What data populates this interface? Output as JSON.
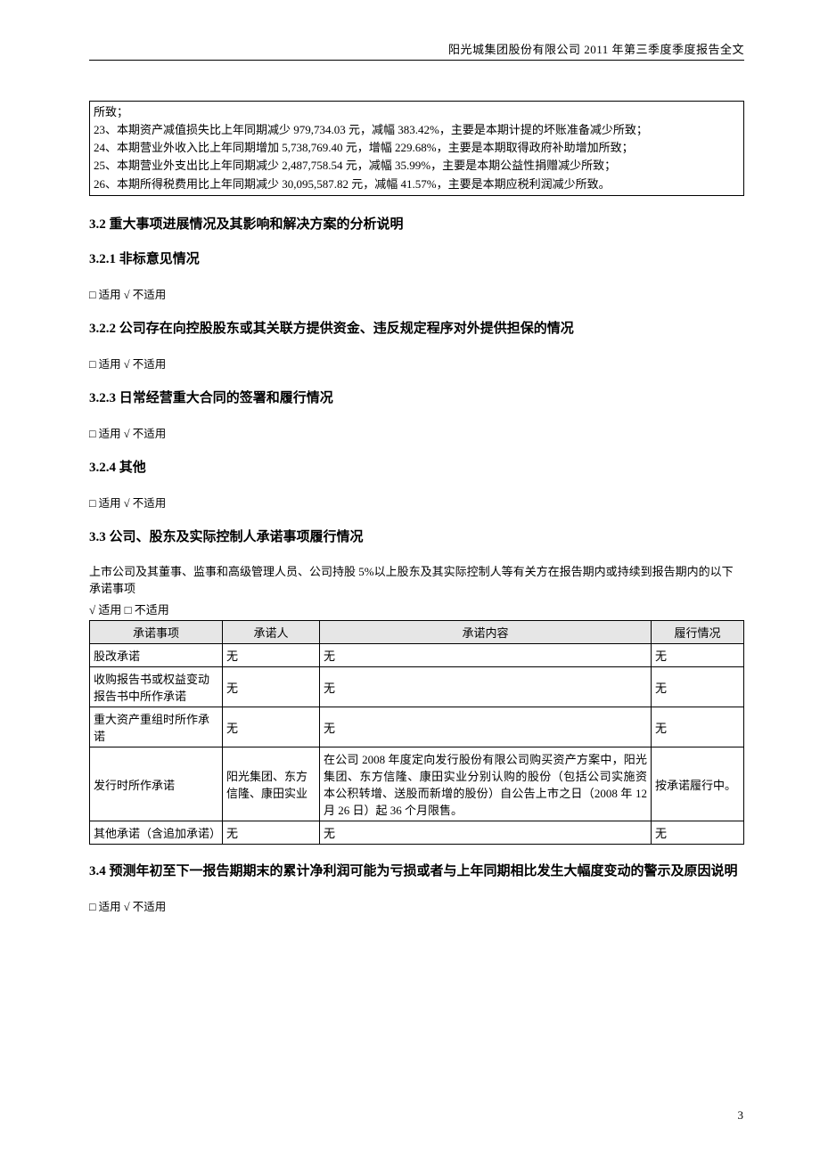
{
  "header": "阳光城集团股份有限公司 2011 年第三季度季度报告全文",
  "box_lines": [
    "所致；",
    "23、本期资产减值损失比上年同期减少 979,734.03 元，减幅 383.42%，主要是本期计提的坏账准备减少所致；",
    "24、本期营业外收入比上年同期增加 5,738,769.40 元，增幅 229.68%，主要是本期取得政府补助增加所致；",
    "25、本期营业外支出比上年同期减少 2,487,758.54 元，减幅 35.99%，主要是本期公益性捐赠减少所致；",
    "26、本期所得税费用比上年同期减少 30,095,587.82 元，减幅 41.57%，主要是本期应税利润减少所致。"
  ],
  "s32": "3.2 重大事项进展情况及其影响和解决方案的分析说明",
  "s321": "3.2.1 非标意见情况",
  "s322": "3.2.2 公司存在向控股股东或其关联方提供资金、违反规定程序对外提供担保的情况",
  "s323": "3.2.3 日常经营重大合同的签署和履行情况",
  "s324": "3.2.4 其他",
  "check_na": "□ 适用 √ 不适用",
  "check_a": "√ 适用 □ 不适用",
  "s33": "3.3 公司、股东及实际控制人承诺事项履行情况",
  "s33_intro": "上市公司及其董事、监事和高级管理人员、公司持股 5%以上股东及其实际控制人等有关方在报告期内或持续到报告期内的以下承诺事项",
  "table_headers": {
    "c1": "承诺事项",
    "c2": "承诺人",
    "c3": "承诺内容",
    "c4": "履行情况"
  },
  "rows": [
    {
      "c1": "股改承诺",
      "c2": "无",
      "c3": "无",
      "c4": "无"
    },
    {
      "c1": "收购报告书或权益变动报告书中所作承诺",
      "c2": "无",
      "c3": "无",
      "c4": "无"
    },
    {
      "c1": "重大资产重组时所作承诺",
      "c2": "无",
      "c3": "无",
      "c4": "无"
    },
    {
      "c1": "发行时所作承诺",
      "c2": "阳光集团、东方信隆、康田实业",
      "c3": "在公司 2008 年度定向发行股份有限公司购买资产方案中，阳光集团、东方信隆、康田实业分别认购的股份（包括公司实施资本公积转增、送股而新增的股份）自公告上市之日（2008 年 12 月 26 日）起 36 个月限售。",
      "c4": "按承诺履行中。"
    },
    {
      "c1": "其他承诺（含追加承诺）",
      "c2": "无",
      "c3": "无",
      "c4": "无"
    }
  ],
  "s34": "3.4 预测年初至下一报告期期末的累计净利润可能为亏损或者与上年同期相比发生大幅度变动的警示及原因说明",
  "page_num": "3"
}
